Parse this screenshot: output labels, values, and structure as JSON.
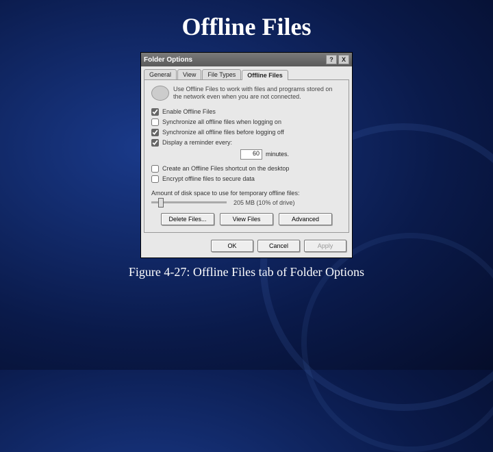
{
  "slide": {
    "title": "Offline Files",
    "caption": "Figure 4-27: Offline Files tab of Folder Options"
  },
  "dialog": {
    "title": "Folder Options",
    "help_label": "?",
    "close_label": "X",
    "tabs": {
      "general": "General",
      "view": "View",
      "filetypes": "File Types",
      "offline": "Offline Files"
    },
    "intro": "Use Offline Files to work with files and programs stored on the network even when you are not connected.",
    "options": {
      "enable": "Enable Offline Files",
      "sync_logon": "Synchronize all offline files when logging on",
      "sync_logoff": "Synchronize all offline files before logging off",
      "reminder": "Display a reminder every:",
      "reminder_value": "60",
      "reminder_unit": "minutes.",
      "shortcut": "Create an Offline Files shortcut on the desktop",
      "encrypt": "Encrypt offline files to secure data"
    },
    "disk": {
      "label": "Amount of disk space to use for temporary offline files:",
      "value": "205 MB (10% of drive)"
    },
    "buttons": {
      "delete": "Delete Files...",
      "view": "View Files",
      "advanced": "Advanced",
      "ok": "OK",
      "cancel": "Cancel",
      "apply": "Apply"
    }
  }
}
